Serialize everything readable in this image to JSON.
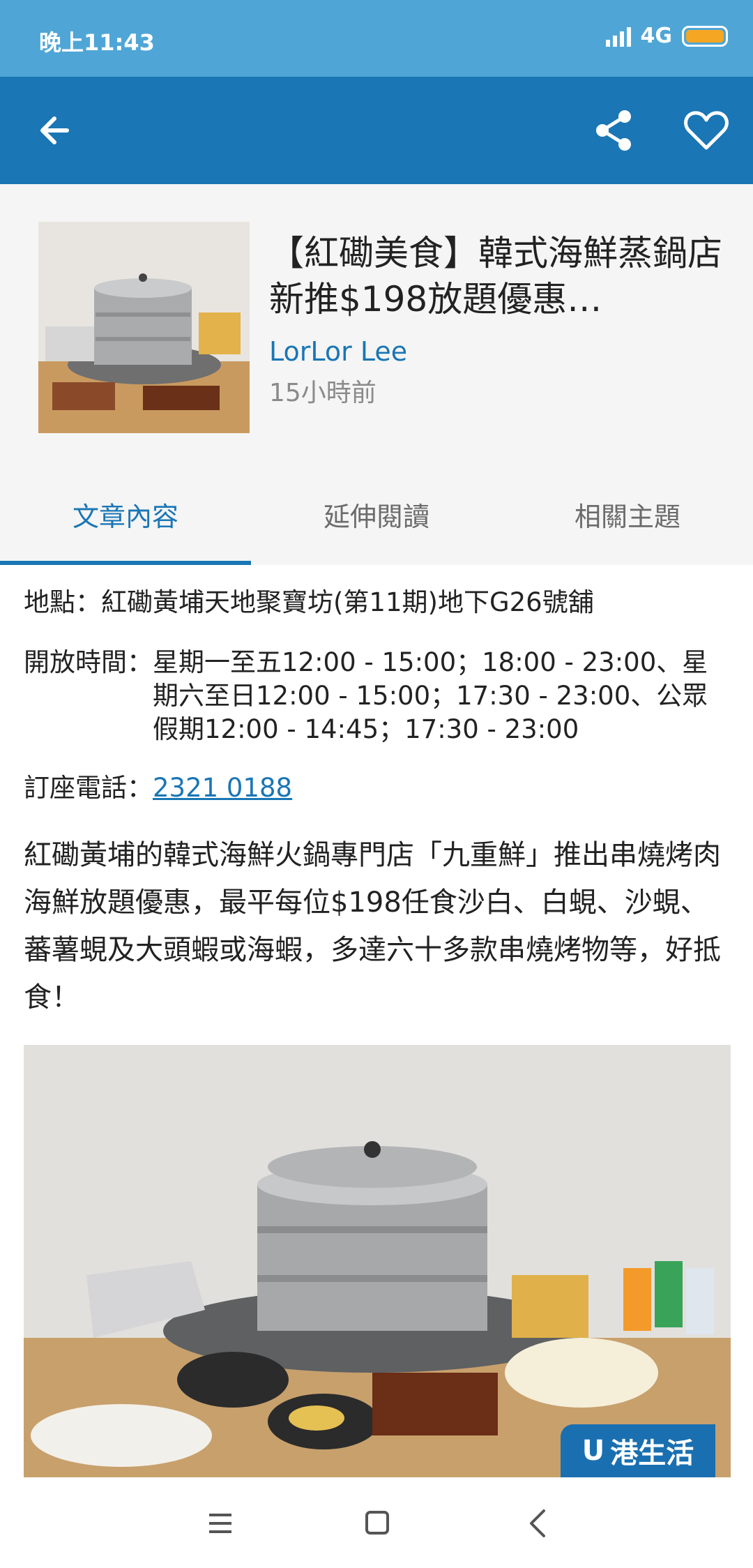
{
  "status_bar": {
    "time": "晚上11:43",
    "network": "4G"
  },
  "header": {
    "title": "【紅磡美食】韓式海鮮蒸鍋店新推$198放題優惠…",
    "author": "LorLor Lee",
    "time_ago": "15小時前"
  },
  "tabs": [
    {
      "label": "文章內容",
      "active": true
    },
    {
      "label": "延伸閱讀",
      "active": false
    },
    {
      "label": "相關主題",
      "active": false
    }
  ],
  "info": {
    "location_label": "地點：",
    "location_value": "紅磡黃埔天地聚寶坊(第11期)地下G26號舖",
    "hours_label": "開放時間：",
    "hours_value": "星期一至五12:00 - 15:00；18:00 - 23:00、星期六至日12:00 - 15:00；17:30 - 23:00、公眾假期12:00 - 14:45；17:30 - 23:00",
    "phone_label": "訂座電話：",
    "phone_value": "2321 0188"
  },
  "body": "紅磡黃埔的韓式海鮮火鍋專門店「九重鮮」推出串燒烤肉海鮮放題優惠，最平每位$198任食沙白、白蜆、沙蜆、蕃薯蜆及大頭蝦或海蝦，多達六十多款串燒烤物等，好抵食！",
  "photo": {
    "watermark": "港生活",
    "watermark_logo": "U"
  },
  "colors": {
    "status_bar": "#4fa6d6",
    "app_bar": "#1a76b5",
    "accent": "#1a76b5"
  }
}
